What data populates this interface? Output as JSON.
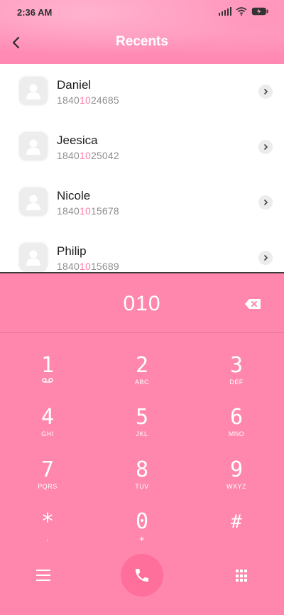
{
  "status_bar": {
    "time": "2:36 AM",
    "icons": [
      "signal-icon",
      "wifi-icon",
      "battery-icon"
    ]
  },
  "header": {
    "back_icon": "back-arrow-icon",
    "title": "Recents"
  },
  "contacts": [
    {
      "name": "Daniel",
      "number_prefix": "1840",
      "number_match": "10",
      "number_suffix": "24685"
    },
    {
      "name": "Jeesica",
      "number_prefix": "1840",
      "number_match": "10",
      "number_suffix": "25042"
    },
    {
      "name": "Nicole",
      "number_prefix": "1840",
      "number_match": "10",
      "number_suffix": "15678"
    },
    {
      "name": "Philip",
      "number_prefix": "1840",
      "number_match": "10",
      "number_suffix": "15689"
    }
  ],
  "dialer": {
    "entered_number": "010",
    "backspace_icon": "backspace-icon",
    "keys": [
      {
        "digit": "1",
        "letters": ""
      },
      {
        "digit": "2",
        "letters": "ABC"
      },
      {
        "digit": "3",
        "letters": "DEF"
      },
      {
        "digit": "4",
        "letters": "GHI"
      },
      {
        "digit": "5",
        "letters": "JKL"
      },
      {
        "digit": "6",
        "letters": "MNO"
      },
      {
        "digit": "7",
        "letters": "PQRS"
      },
      {
        "digit": "8",
        "letters": "TUV"
      },
      {
        "digit": "9",
        "letters": "WXYZ"
      },
      {
        "digit": "*",
        "letters": ","
      },
      {
        "digit": "0",
        "letters": "+"
      },
      {
        "digit": "#",
        "letters": ""
      }
    ],
    "bottom_icons": [
      "menu-icon",
      "phone-icon",
      "keypad-icon"
    ]
  },
  "colors": {
    "accent": "#ff87ad",
    "highlight": "#ff7fa6",
    "call_button": "#ff6f9c"
  }
}
